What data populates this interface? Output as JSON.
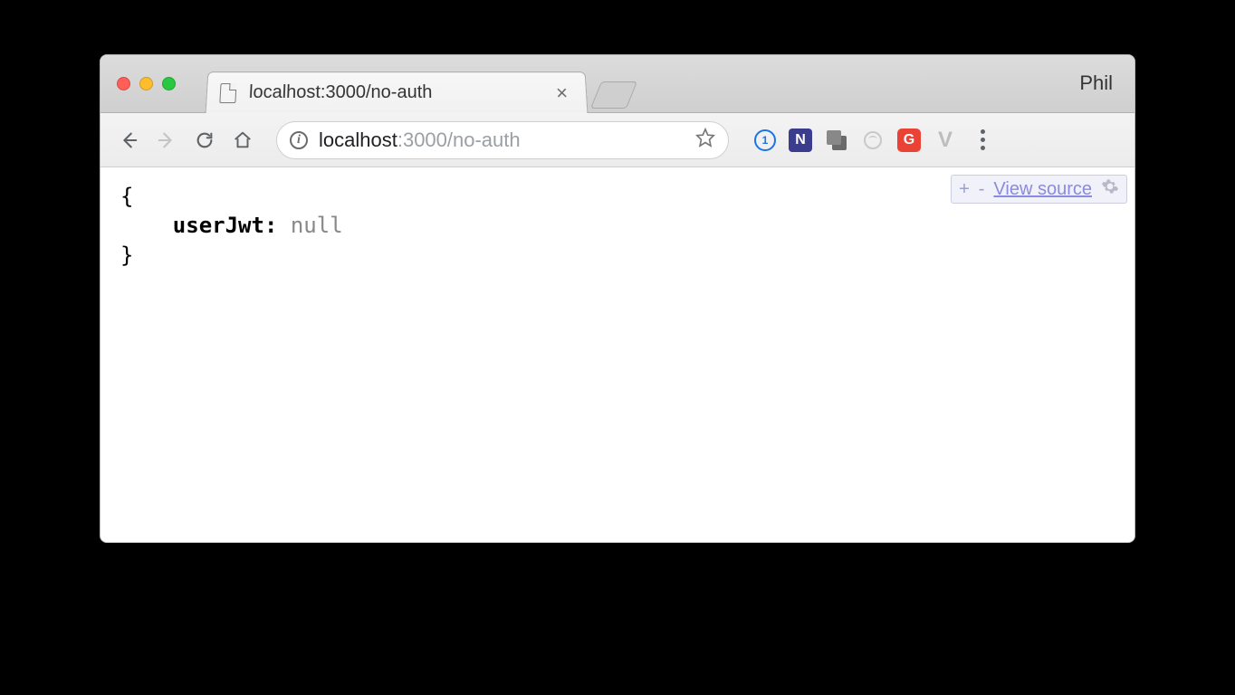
{
  "window": {
    "profile_name": "Phil"
  },
  "tab": {
    "title": "localhost:3000/no-auth"
  },
  "address": {
    "host": "localhost",
    "port_path": ":3000/no-auth"
  },
  "json_viewer": {
    "plus": "+",
    "minus": "-",
    "view_source": "View source",
    "open_brace": "{",
    "key": "userJwt",
    "colon": ":",
    "value": "null",
    "close_brace": "}"
  },
  "ext": {
    "onepassword": "1",
    "n": "N",
    "grammarly": "G",
    "vue": "V"
  }
}
